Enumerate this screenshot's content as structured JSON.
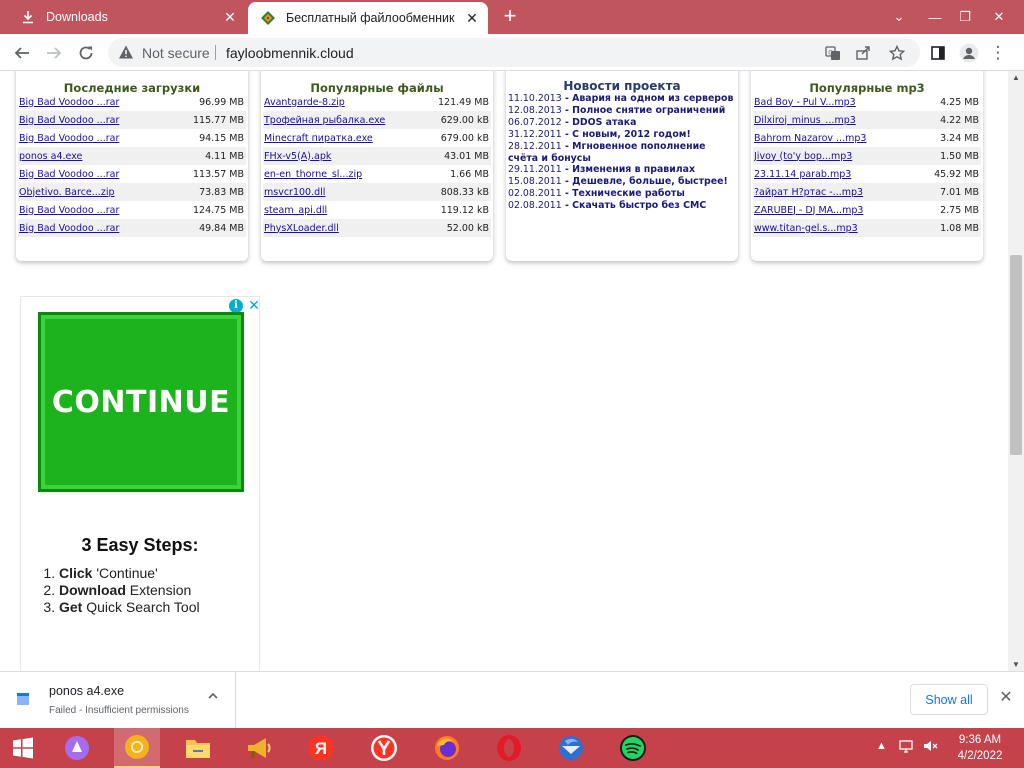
{
  "browser": {
    "tabs": [
      {
        "title": "Downloads"
      },
      {
        "title": "Бесплатный файлообменник бе"
      }
    ],
    "security_label": "Not secure",
    "url": "fayloobmennik.cloud"
  },
  "sections": {
    "recent": {
      "title": "Последние загрузки",
      "items": [
        {
          "name": "Big Bad Voodoo ...rar",
          "size": "96.99 MB"
        },
        {
          "name": "Big Bad Voodoo ...rar",
          "size": "115.77 MB"
        },
        {
          "name": "Big Bad Voodoo ...rar",
          "size": "94.15 MB"
        },
        {
          "name": "ponos a4.exe",
          "size": "4.11 MB"
        },
        {
          "name": "Big Bad Voodoo ...rar",
          "size": "113.57 MB"
        },
        {
          "name": "Objetivo. Barce...zip",
          "size": "73.83 MB"
        },
        {
          "name": "Big Bad Voodoo ...rar",
          "size": "124.75 MB"
        },
        {
          "name": "Big Bad Voodoo ...rar",
          "size": "49.84 MB"
        }
      ]
    },
    "popular_files": {
      "title": "Популярные файлы",
      "items": [
        {
          "name": "Avantgarde-8.zip",
          "size": "121.49 MB"
        },
        {
          "name": "Трофейная рыбалка.exe",
          "size": "629.00 kB"
        },
        {
          "name": "Minecraft пиратка.exe",
          "size": "679.00 kB"
        },
        {
          "name": "FHx-v5(A).apk",
          "size": "43.01 MB"
        },
        {
          "name": "en-en_thorne_sl...zip",
          "size": "1.66 MB"
        },
        {
          "name": "msvcr100.dll",
          "size": "808.33 kB"
        },
        {
          "name": "steam_api.dll",
          "size": "119.12 kB"
        },
        {
          "name": "PhysXLoader.dll",
          "size": "52.00 kB"
        }
      ]
    },
    "news": {
      "title": "Новости проекта",
      "items": [
        {
          "date": "11.10.2013",
          "text": "Авария на одном из серверов"
        },
        {
          "date": "12.08.2013",
          "text": "Полное снятие ограничений"
        },
        {
          "date": "06.07.2012",
          "text": "DDOS атака"
        },
        {
          "date": "31.12.2011",
          "text": "С новым, 2012 годом!"
        },
        {
          "date": "28.12.2011",
          "text": "Мгновенное пополнение счёта и бонусы"
        },
        {
          "date": "29.11.2011",
          "text": "Изменения в правилах"
        },
        {
          "date": "15.08.2011",
          "text": "Дешевле, больше, быстрее!"
        },
        {
          "date": "02.08.2011",
          "text": "Технические работы"
        },
        {
          "date": "02.08.2011",
          "text": "Скачать быстро без СМС"
        }
      ]
    },
    "popular_mp3": {
      "title": "Популярные mp3",
      "items": [
        {
          "name": "Bad Boy - Pul V...mp3",
          "size": "4.25 MB"
        },
        {
          "name": "Dilxiroj_minus_...mp3",
          "size": "4.22 MB"
        },
        {
          "name": "Bahrom Nazarov ...mp3",
          "size": "3.24 MB"
        },
        {
          "name": "Jivoy (to'y bop...mp3",
          "size": "1.50 MB"
        },
        {
          "name": "23.11.14 parab.mp3",
          "size": "45.92 MB"
        },
        {
          "name": "?айрат Н?ртас -...mp3",
          "size": "7.01 MB"
        },
        {
          "name": "ZARUBEJ - DJ MA...mp3",
          "size": "2.75 MB"
        },
        {
          "name": "www.titan-gel.s...mp3",
          "size": "1.08 MB"
        }
      ]
    }
  },
  "ad": {
    "button_label": "CONTINUE",
    "steps_title": "3 Easy Steps:",
    "steps": [
      {
        "bold": "Click",
        "rest": " 'Continue'"
      },
      {
        "bold": "Download",
        "rest": " Extension"
      },
      {
        "bold": "Get",
        "rest": " Quick Search Tool"
      }
    ]
  },
  "download_shelf": {
    "file_name": "ponos a4.exe",
    "status": "Failed - Insufficient permissions",
    "show_all_label": "Show all"
  },
  "taskbar": {
    "time": "9:36 AM",
    "date": "4/2/2022"
  },
  "colors": {
    "tabstrip": "#c1555d",
    "taskbar": "#c5424a",
    "link": "#1a0dab",
    "news": "#1a1a7a"
  }
}
